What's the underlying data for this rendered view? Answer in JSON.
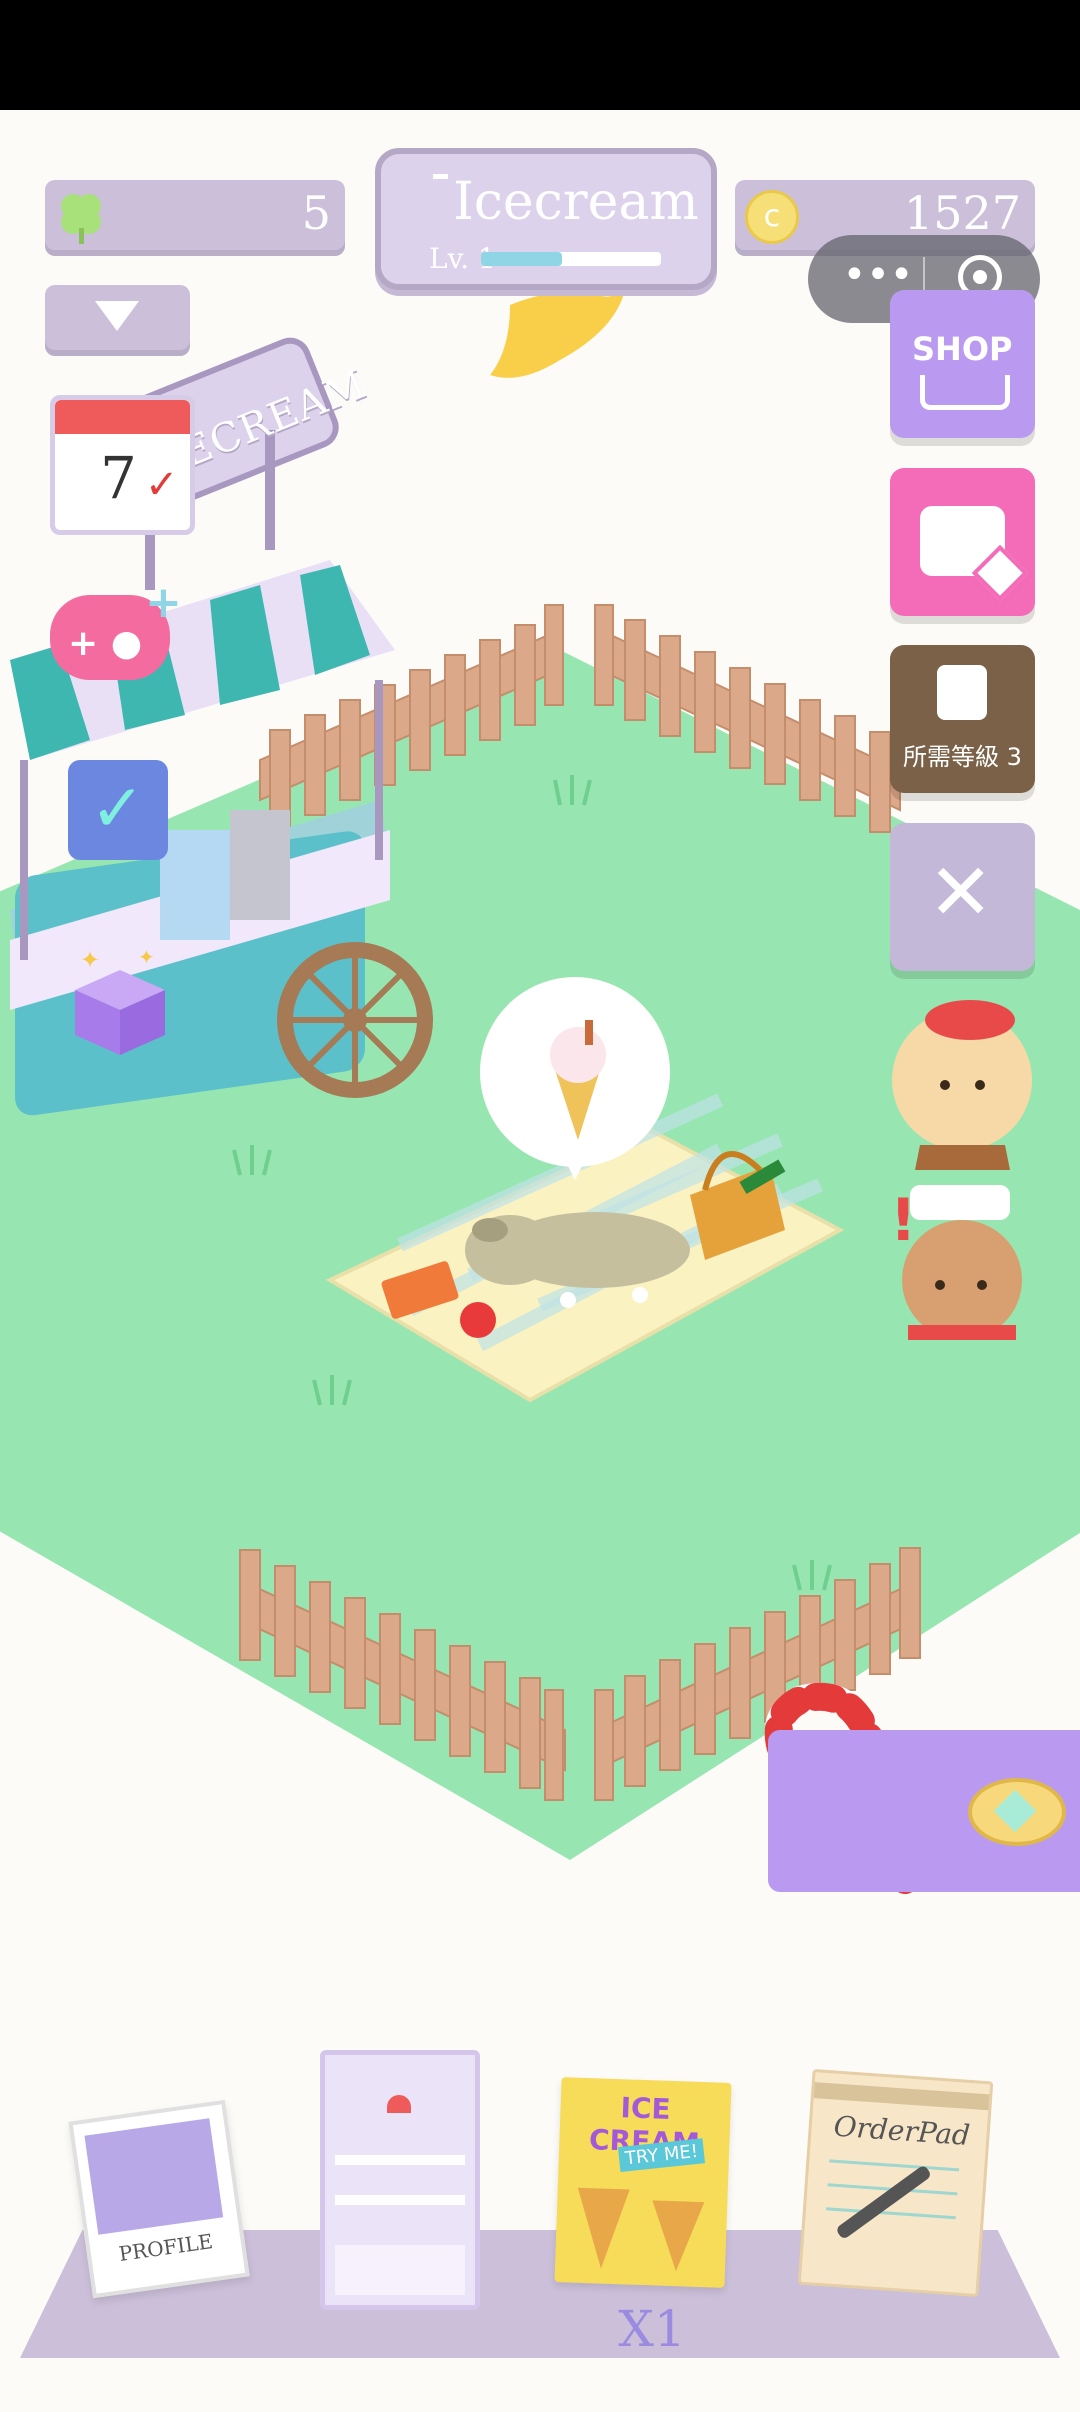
{
  "top": {
    "clover_count": "5",
    "title": "Icecream",
    "level": "Lv. 1",
    "level_progress": 0.45,
    "coins": "1527"
  },
  "side": {
    "shop_label": "SHOP",
    "locked_label": "所需等級 3"
  },
  "scene": {
    "stand_sign": "ICECREAM"
  },
  "bottom": {
    "profile_label": "PROFILE",
    "poster_title": "ICE CREAM",
    "poster_sub": "TRY ME!",
    "orderpad_label": "OrderPad",
    "multiplier": "X1"
  },
  "colors": {
    "grass": "#97e6b1",
    "fence": "#dba889",
    "ui_purple": "#cbbfd9",
    "accent_purple": "#b99af0",
    "chest_pink": "#f46bb8",
    "locked_brown": "#7a6147"
  }
}
